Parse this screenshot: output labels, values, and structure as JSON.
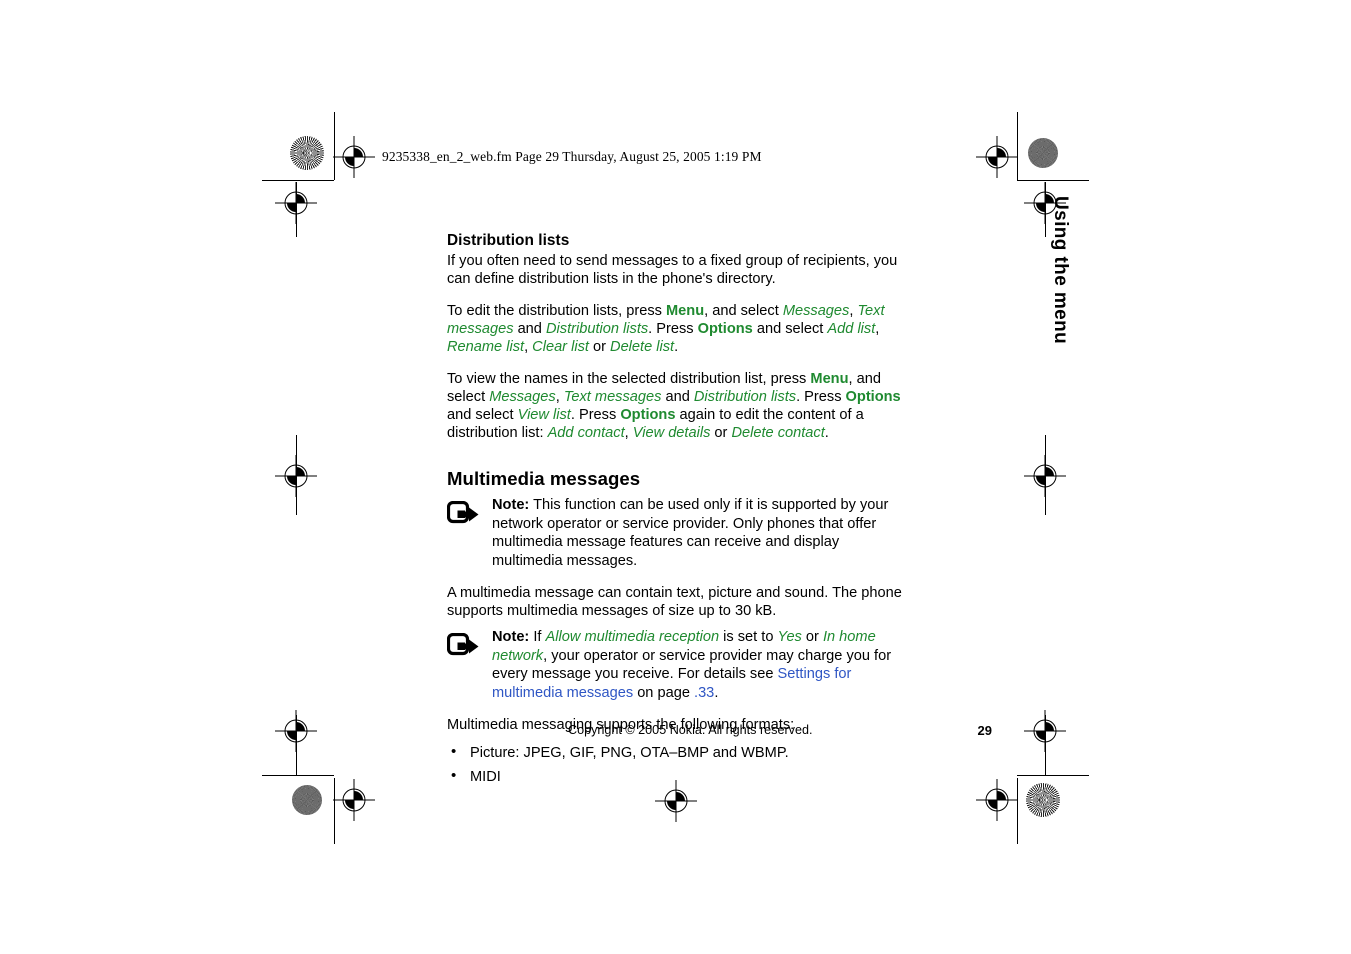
{
  "print_header": {
    "filename_line": "9235338_en_2_web.fm  Page 29  Thursday, August 25, 2005  1:19 PM"
  },
  "side_tab": {
    "label": "Using the menu"
  },
  "colors": {
    "menu_green": "#1f8a30",
    "link_blue": "#2f56c4",
    "text_black": "#000000",
    "page_background": "#ffffff"
  },
  "content": {
    "section_distribution": {
      "heading": "Distribution lists",
      "para1": {
        "text": "If you often need to send messages to a fixed group of recipients, you can define distribution lists in the phone's directory."
      },
      "para2": {
        "seg1": "To edit the distribution lists, press ",
        "key_menu": "Menu",
        "seg2": ", and select ",
        "item_messages": "Messages",
        "seg3": ", ",
        "item_text_messages": "Text messages",
        "seg4": " and ",
        "item_distribution_lists": "Distribution lists",
        "seg5": ". Press ",
        "key_options": "Options",
        "seg6": " and select ",
        "item_add_list": "Add list",
        "seg7": ", ",
        "item_rename_list": "Rename list",
        "seg8": ", ",
        "item_clear_list": "Clear list",
        "seg9": " or ",
        "item_delete_list": "Delete list",
        "seg10": "."
      },
      "para3": {
        "seg1": "To view the names in the selected distribution list, press ",
        "key_menu": "Menu",
        "seg2": ", and select ",
        "item_messages": "Messages",
        "seg3": ", ",
        "item_text_messages": "Text messages",
        "seg4": " and ",
        "item_distribution_lists": "Distribution lists",
        "seg5": ". Press ",
        "key_options": "Options",
        "seg6": " and select ",
        "item_view_list": "View list",
        "seg7": ". Press ",
        "key_options2": "Options",
        "seg8": " again to edit the content of a distribution list: ",
        "item_add_contact": "Add contact",
        "seg9": ", ",
        "item_view_details": "View details",
        "seg10": " or ",
        "item_delete_contact": "Delete contact",
        "seg11": "."
      }
    },
    "section_multimedia": {
      "heading": "Multimedia messages",
      "note1": {
        "icon": "note-pointer-icon",
        "label": "Note:",
        "text": " This function can be used only if it is supported by your network operator or service provider. Only phones that offer multimedia message features can receive and display multimedia messages."
      },
      "para1": {
        "text": "A multimedia message can contain text, picture and sound. The phone supports multimedia messages of size up to 30 kB."
      },
      "note2": {
        "icon": "note-pointer-icon",
        "label": "Note:",
        "seg1": " If ",
        "setting_name": "Allow multimedia reception",
        "seg2": " is set to ",
        "value_yes": "Yes",
        "seg3": " or ",
        "value_in_home_network": "In home network",
        "seg4": ", your operator or service provider may charge you for every message you receive. For details see ",
        "link_text": "Settings for multimedia messages",
        "seg5": " on page ",
        "link_page": ".33",
        "seg6": "."
      },
      "formats_intro": "Multimedia messaging supports the following formats:",
      "formats": [
        "Picture: JPEG, GIF, PNG, OTA–BMP and WBMP.",
        "MIDI"
      ]
    }
  },
  "footer": {
    "copyright": "Copyright © 2005 Nokia. All rights reserved.",
    "page_number": "29"
  }
}
